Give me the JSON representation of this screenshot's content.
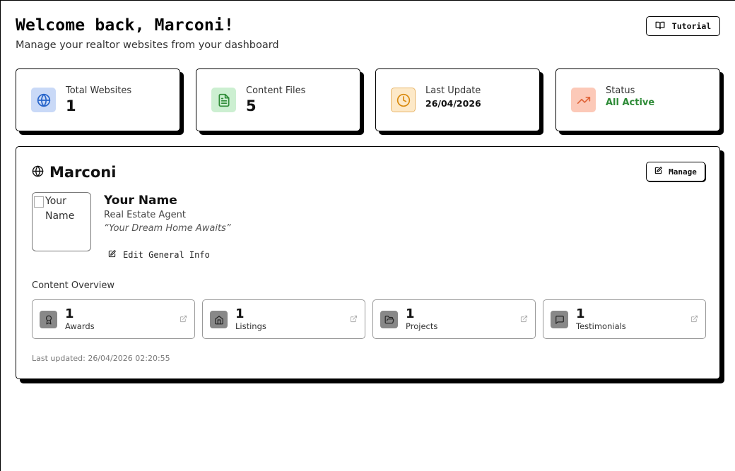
{
  "header": {
    "title": "Welcome back, Marconi!",
    "subtitle": "Manage your realtor websites from your dashboard",
    "tutorial_label": "Tutorial"
  },
  "stats": [
    {
      "label": "Total Websites",
      "value": "1",
      "icon": "globe-icon",
      "icon_bg": "#c9d9f7",
      "icon_color": "#2563c9"
    },
    {
      "label": "Content Files",
      "value": "5",
      "icon": "file-text-icon",
      "icon_bg": "#ccefd1",
      "icon_color": "#2e8b37"
    },
    {
      "label": "Last Update",
      "value": "26/04/2026",
      "icon": "clock-icon",
      "icon_bg": "#fde9c8",
      "icon_color": "#d98a0e"
    },
    {
      "label": "Status",
      "value": "All Active",
      "icon": "trending-up-icon",
      "icon_bg": "#fcc9b8",
      "icon_color": "#e0653a"
    }
  ],
  "website": {
    "name": "Marconi",
    "manage_label": "Manage",
    "avatar_alt": "Your Name",
    "agent_name": "Your Name",
    "agent_role": "Real Estate Agent",
    "tagline": "“Your Dream Home Awaits”",
    "edit_label": "Edit General Info",
    "overview_label": "Content Overview",
    "content": [
      {
        "count": "1",
        "label": "Awards",
        "icon": "award-icon"
      },
      {
        "count": "1",
        "label": "Listings",
        "icon": "home-icon"
      },
      {
        "count": "1",
        "label": "Projects",
        "icon": "folder-open-icon"
      },
      {
        "count": "1",
        "label": "Testimonials",
        "icon": "message-square-icon"
      }
    ],
    "last_updated": "Last updated: 26/04/2026 02:20:55"
  }
}
